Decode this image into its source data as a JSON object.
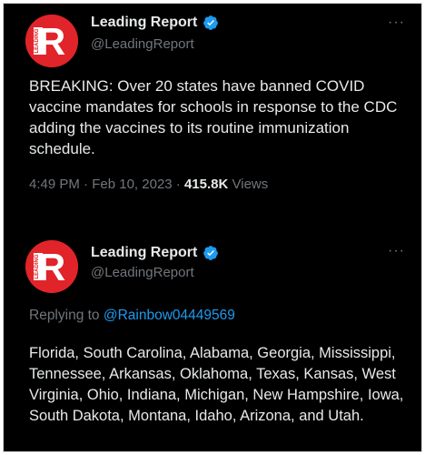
{
  "tweets": [
    {
      "display_name": "Leading Report",
      "handle": "@LeadingReport",
      "more_label": "···",
      "avatar_text": "LEADING",
      "avatar_letter": "R",
      "text": "BREAKING: Over 20 states have banned COVID vaccine mandates for schools in response to the CDC adding the vaccines to its routine immunization schedule.",
      "time": "4:49 PM",
      "separator": "·",
      "date": "Feb 10, 2023",
      "views_count": "415.8K",
      "views_label": "Views"
    },
    {
      "display_name": "Leading Report",
      "handle": "@LeadingReport",
      "more_label": "···",
      "avatar_text": "LEADING",
      "avatar_letter": "R",
      "replying_label": "Replying to",
      "replying_mention": "@Rainbow04449569",
      "text": "Florida, South Carolina, Alabama, Georgia, Mississippi, Tennessee, Arkansas, Oklahoma, Texas, Kansas, West Virginia, Ohio, Indiana, Michigan, New Hampshire, Iowa, South Dakota, Montana, Idaho, Arizona, and Utah."
    }
  ],
  "colors": {
    "background": "#000000",
    "primary_text": "#e7e9ea",
    "secondary_text": "#71767b",
    "link": "#1d9bf0",
    "avatar_red": "#e0242a",
    "verified_blue": "#1d9bf0"
  },
  "icons": {
    "verified": "verified-badge-icon",
    "more": "more-options-icon"
  }
}
